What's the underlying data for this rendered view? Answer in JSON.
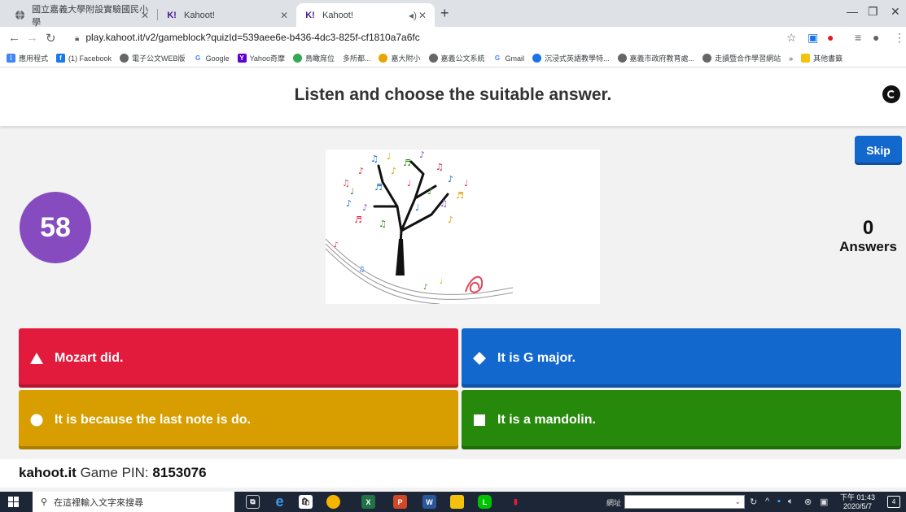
{
  "browser": {
    "tabs": [
      {
        "title": "國立嘉義大學附設實驗國民小學",
        "favicon": "globe-icon"
      },
      {
        "title": "Kahoot!",
        "favicon": "K!"
      },
      {
        "title": "Kahoot!",
        "favicon": "K!"
      }
    ],
    "url": "play.kahoot.it/v2/gameblock?quizId=539aee6e-b436-4dc3-825f-cf1810a7a6fc",
    "bookmarks": [
      "應用程式",
      "(1) Facebook",
      "電子公文WEB版",
      "Google",
      "Yahoo奇摩",
      "鳥瞰席位",
      "多所都...",
      "嘉大附小",
      "嘉義公文系統",
      "Gmail",
      "沉浸式英語教學特...",
      "嘉義市政府教育處...",
      "走讀暨合作學習網站",
      "»",
      "其他書籤"
    ]
  },
  "kahoot": {
    "question": "Listen and choose the suitable answer.",
    "skip_label": "Skip",
    "timer": "58",
    "answers_count": "0",
    "answers_label": "Answers",
    "answers": [
      {
        "text": "Mozart did.",
        "shape": "triangle",
        "color": "#e21b3c"
      },
      {
        "text": "It is G major.",
        "shape": "diamond",
        "color": "#1368ce"
      },
      {
        "text": "It is because the last note is do.",
        "shape": "circle",
        "color": "#d89e00"
      },
      {
        "text": "It is a mandolin.",
        "shape": "square",
        "color": "#26890c"
      }
    ],
    "footer_site": "kahoot.it",
    "footer_pin_label": "Game PIN:",
    "footer_pin": "8153076"
  },
  "taskbar": {
    "search_placeholder": "在這裡輸入文字來搜尋",
    "address_label": "網址",
    "clock_time": "下午 01:43",
    "clock_date": "2020/5/7",
    "notification_count": "4"
  }
}
